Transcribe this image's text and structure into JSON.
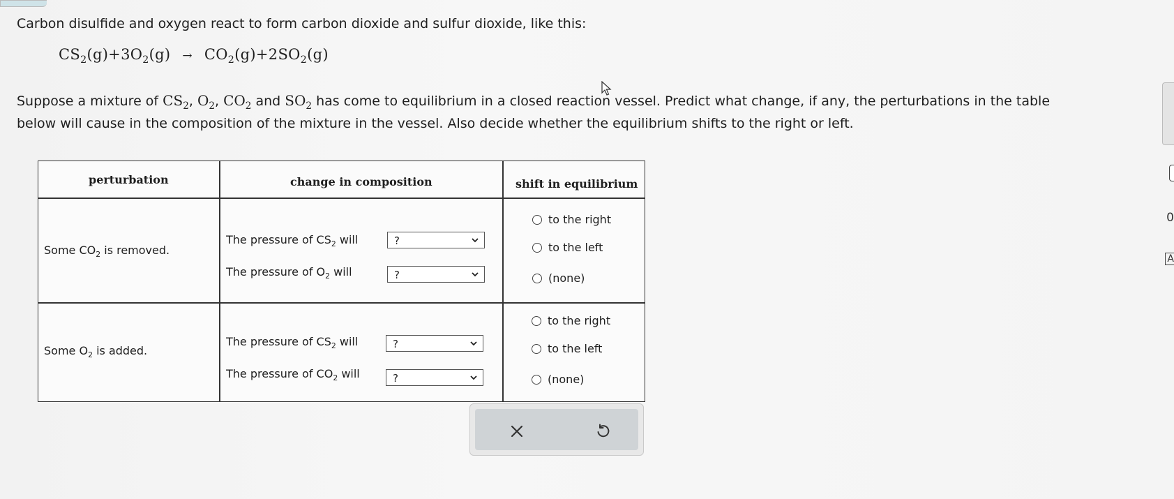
{
  "intro_text": "Carbon disulfide and oxygen react to form carbon dioxide and sulfur dioxide, like this:",
  "equation": {
    "lhs1": "CS",
    "lhs1_sub": "2",
    "lhs1_phase": "(g)+3O",
    "lhs2_sub": "2",
    "lhs2_phase": "(g)",
    "arrow": "→",
    "rhs1": "CO",
    "rhs1_sub": "2",
    "rhs1_phase": "(g)+2SO",
    "rhs2_sub": "2",
    "rhs2_phase": "(g)"
  },
  "paragraph": {
    "p1": "Suppose a mixture of",
    "s1": "CS",
    "s1_sub": "2",
    "c1": ",",
    "s2": "O",
    "s2_sub": "2",
    "c2": ",",
    "s3": "CO",
    "s3_sub": "2",
    "and": "and",
    "s4": "SO",
    "s4_sub": "2",
    "p2": "has come to equilibrium in a closed reaction vessel. Predict what change, if any, the perturbations in the table",
    "p3": "below will cause in the composition of the mixture in the vessel. Also decide whether the equilibrium shifts to the right or left."
  },
  "table": {
    "headers": [
      "perturbation",
      "change in composition",
      "shift in equilibrium"
    ],
    "rows": [
      {
        "perturbation_pre": "Some CO",
        "perturbation_sub": "2",
        "perturbation_post": " is removed.",
        "changes": [
          {
            "pre": "The pressure of CS",
            "sub": "2",
            "post": " will",
            "selected": "?"
          },
          {
            "pre": "The pressure of O",
            "sub": "2",
            "post": " will",
            "selected": "?"
          }
        ],
        "options": [
          "to the right",
          "to the left",
          "(none)"
        ]
      },
      {
        "perturbation_pre": "Some O",
        "perturbation_sub": "2",
        "perturbation_post": " is added.",
        "changes": [
          {
            "pre": "The pressure of CS",
            "sub": "2",
            "post": " will",
            "selected": "?"
          },
          {
            "pre": "The pressure of CO",
            "sub": "2",
            "post": " will",
            "selected": "?"
          }
        ],
        "options": [
          "to the right",
          "to the left",
          "(none)"
        ]
      }
    ]
  },
  "actions": {
    "clear_icon": "close-icon",
    "undo_icon": "undo-icon"
  },
  "edge_tabs": [
    "0",
    "A"
  ],
  "colors": {
    "background": "#f6f6f6",
    "action_bar": "#cfd3d6",
    "border": "#333333"
  }
}
